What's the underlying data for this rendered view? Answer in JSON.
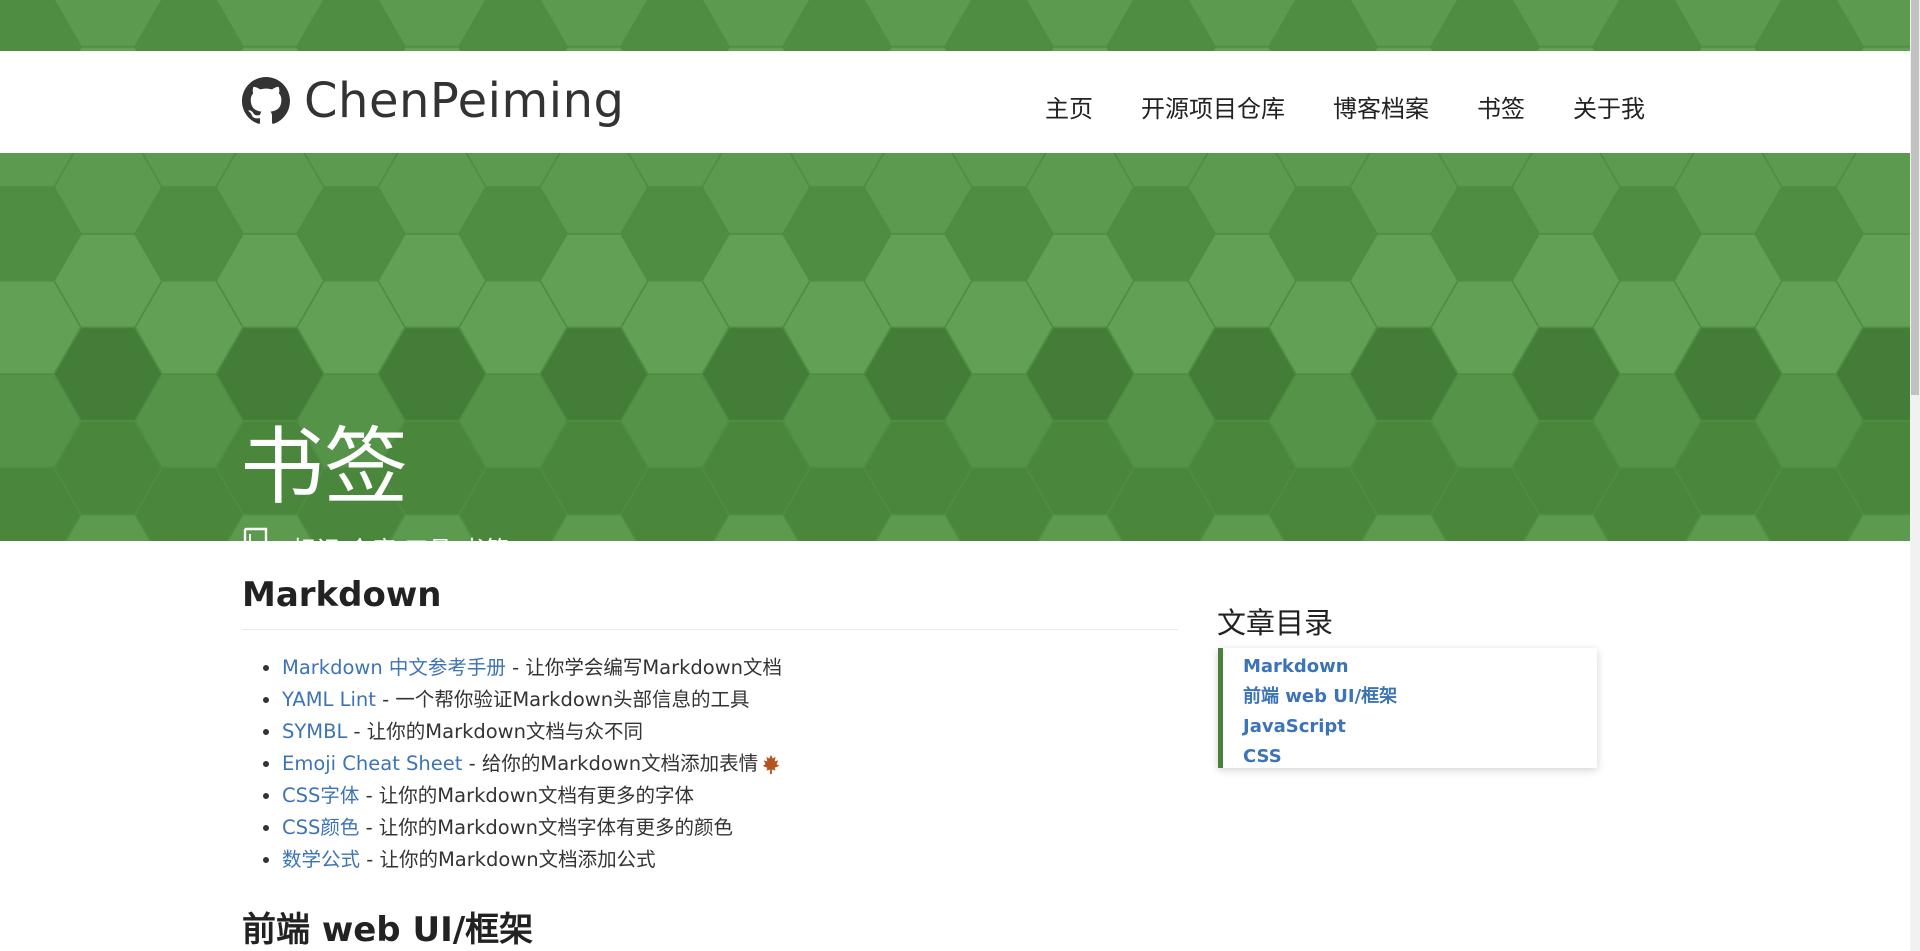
{
  "header": {
    "brand": "ChenPeiming",
    "nav": [
      "主页",
      "开源项目仓库",
      "博客档案",
      "书签",
      "关于我"
    ]
  },
  "hero": {
    "title": "书签",
    "subtitle": "标记 仓库-工具-书籍"
  },
  "sections": [
    {
      "title": "Markdown",
      "items": [
        {
          "link": "Markdown 中文参考手册",
          "desc": " - 让你学会编写Markdown文档"
        },
        {
          "link": "YAML Lint",
          "desc": " - 一个帮你验证Markdown头部信息的工具"
        },
        {
          "link": "SYMBL",
          "desc": " - 让你的Markdown文档与众不同"
        },
        {
          "link": "Emoji Cheat Sheet",
          "desc": " - 给你的Markdown文档添加表情"
        },
        {
          "link": "CSS字体",
          "desc": " - 让你的Markdown文档有更多的字体"
        },
        {
          "link": "CSS颜色",
          "desc": " - 让你的Markdown文档字体有更多的颜色"
        },
        {
          "link": "数学公式",
          "desc": " - 让你的Markdown文档添加公式"
        }
      ]
    },
    {
      "title": "前端 web UI/框架"
    }
  ],
  "toc": {
    "title": "文章目录",
    "items": [
      "Markdown",
      "前端 web UI/框架",
      "JavaScript",
      "CSS"
    ]
  },
  "colors": {
    "hero_green": "#4f8d42",
    "link_blue": "#3d74b5",
    "toc_border": "#4b7f3d"
  },
  "icons": [
    "github-icon",
    "bookmark-icon",
    "maple-leaf-emoji"
  ]
}
